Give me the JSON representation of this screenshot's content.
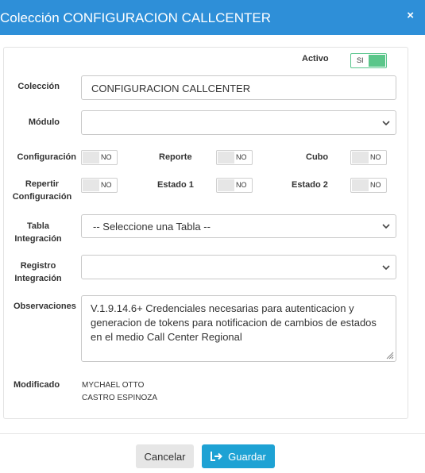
{
  "header": {
    "title": "Colección CONFIGURACION CALLCENTER",
    "close_icon": "×"
  },
  "activo": {
    "label": "Activo",
    "value": "SI"
  },
  "coleccion": {
    "label": "Colección",
    "value": "CONFIGURACION CALLCENTER"
  },
  "modulo": {
    "label": "Módulo",
    "value": ""
  },
  "toggles": {
    "configuracion": {
      "label": "Configuración",
      "value": "NO"
    },
    "reporte": {
      "label": "Reporte",
      "value": "NO"
    },
    "cubo": {
      "label": "Cubo",
      "value": "NO"
    },
    "repertir": {
      "label_line1": "Repertir",
      "label_line2": "Configuración",
      "value": "NO"
    },
    "estado1": {
      "label": "Estado 1",
      "value": "NO"
    },
    "estado2": {
      "label": "Estado 2",
      "value": "NO"
    }
  },
  "tabla_integracion": {
    "label_line1": "Tabla",
    "label_line2": "Integración",
    "value": "-- Seleccione una Tabla --"
  },
  "registro_integracion": {
    "label_line1": "Registro",
    "label_line2": "Integración",
    "value": ""
  },
  "observaciones": {
    "label": "Observaciones",
    "value": "V.1.9.14.6+ Credenciales necesarias para autenticacion y generacion de tokens para notificacion de cambios de estados en el medio Call Center Regional"
  },
  "modificado": {
    "label": "Modificado",
    "line1": "MYCHAEL OTTO",
    "line2": "CASTRO ESPINOZA"
  },
  "footer": {
    "cancel_label": "Cancelar",
    "save_label": "Guardar"
  },
  "colors": {
    "header": "#2e8fd8",
    "toggle_on": "#5bc68a",
    "save_button": "#1ea2d4"
  }
}
